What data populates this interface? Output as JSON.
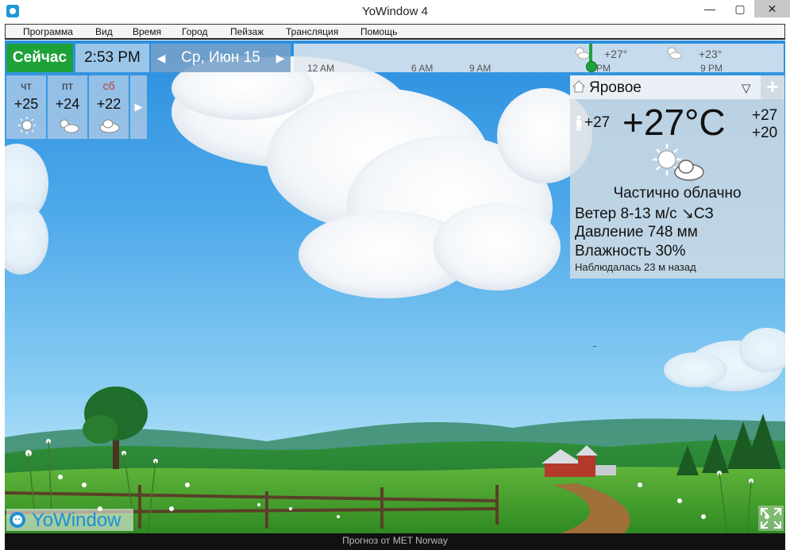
{
  "window": {
    "title": "YoWindow 4",
    "minimize": "—",
    "maximize": "▢",
    "close": "✕"
  },
  "menu": [
    {
      "label": "Программа"
    },
    {
      "label": "Вид"
    },
    {
      "label": "Время"
    },
    {
      "label": "Город"
    },
    {
      "label": "Пейзаж"
    },
    {
      "label": "Трансляция"
    },
    {
      "label": "Помощь"
    }
  ],
  "topbar": {
    "now_label": "Сейчас",
    "time": "2:53 PM",
    "date": "Ср, Июн 15",
    "prev_arrow": "◀",
    "next_arrow": "▶"
  },
  "timeline": {
    "labels": [
      "12 AM",
      "6 AM",
      "9 AM",
      "PM",
      "9 PM"
    ],
    "temps": [
      "+27°",
      "+23°"
    ]
  },
  "forecast": {
    "days": [
      {
        "name": "чт",
        "temp": "+25",
        "icon": "sun-icon",
        "weekend": false
      },
      {
        "name": "пт",
        "temp": "+24",
        "icon": "sun-cloud-icon",
        "weekend": false
      },
      {
        "name": "сб",
        "temp": "+22",
        "icon": "cloud-icon",
        "weekend": true
      }
    ],
    "next_arrow": "▶",
    "weekend_color": "#c0392b"
  },
  "panel": {
    "city": "Яровое",
    "dropdown": "▽",
    "add": "+",
    "feels_temp": "+27",
    "main_temp": "+27°C",
    "high": "+27",
    "low": "+20",
    "condition": "Частично облачно",
    "wind": "Ветер  8-13 м/с ↘СЗ",
    "pressure": "Давление  748 мм",
    "humidity": "Влажность  30%",
    "observed": "Наблюдалась 23 м назад"
  },
  "logo": {
    "text": "YoWindow"
  },
  "status": {
    "text": "Прогноз от MET Norway"
  },
  "colors": {
    "now_green": "#1fa13a",
    "logo_blue": "#1e8fd8"
  }
}
